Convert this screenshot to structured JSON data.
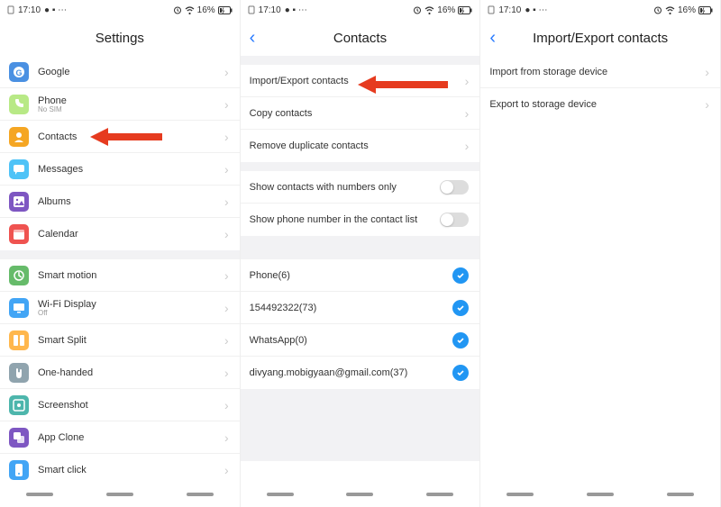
{
  "status": {
    "time": "17:10",
    "battery": "16%"
  },
  "panel1": {
    "title": "Settings",
    "items": [
      {
        "label": "Google",
        "sub": "",
        "icon": "google",
        "color": "bg-blue"
      },
      {
        "label": "Phone",
        "sub": "No SIM",
        "icon": "phone",
        "color": "bg-lgreen"
      },
      {
        "label": "Contacts",
        "sub": "",
        "icon": "contacts",
        "color": "bg-orange",
        "arrow": true
      },
      {
        "label": "Messages",
        "sub": "",
        "icon": "messages",
        "color": "bg-cyan"
      },
      {
        "label": "Albums",
        "sub": "",
        "icon": "albums",
        "color": "bg-purple"
      },
      {
        "label": "Calendar",
        "sub": "",
        "icon": "calendar",
        "color": "bg-red"
      }
    ],
    "items2": [
      {
        "label": "Smart motion",
        "sub": "",
        "icon": "motion",
        "color": "bg-green"
      },
      {
        "label": "Wi-Fi Display",
        "sub": "Off",
        "icon": "wifi-display",
        "color": "bg-lblue"
      },
      {
        "label": "Smart Split",
        "sub": "",
        "icon": "split",
        "color": "bg-yellow"
      },
      {
        "label": "One-handed",
        "sub": "",
        "icon": "one-handed",
        "color": "bg-grey"
      },
      {
        "label": "Screenshot",
        "sub": "",
        "icon": "screenshot",
        "color": "bg-teal"
      },
      {
        "label": "App Clone",
        "sub": "",
        "icon": "app-clone",
        "color": "bg-purple"
      },
      {
        "label": "Smart click",
        "sub": "",
        "icon": "smart-click",
        "color": "bg-lblue"
      }
    ]
  },
  "panel2": {
    "title": "Contacts",
    "actions": [
      {
        "label": "Import/Export contacts",
        "arrow": true
      },
      {
        "label": "Copy contacts"
      },
      {
        "label": "Remove duplicate contacts"
      }
    ],
    "toggles": [
      {
        "label": "Show contacts with numbers only"
      },
      {
        "label": "Show phone number in the contact list"
      }
    ],
    "accounts": [
      {
        "label": "Phone(6)"
      },
      {
        "label": "154492322(73)"
      },
      {
        "label": "WhatsApp(0)"
      },
      {
        "label": "divyang.mobigyaan@gmail.com(37)"
      }
    ]
  },
  "panel3": {
    "title": "Import/Export contacts",
    "items": [
      {
        "label": "Import from storage device"
      },
      {
        "label": "Export to storage device"
      }
    ]
  }
}
